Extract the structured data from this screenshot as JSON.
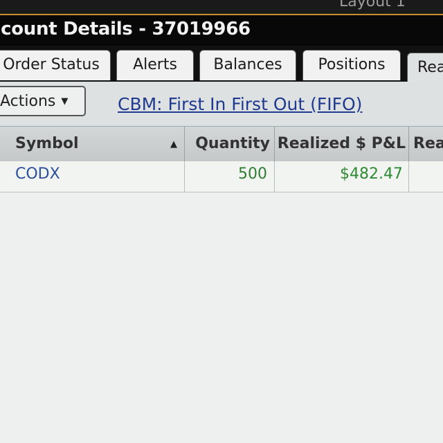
{
  "header": {
    "top_partial_right": "Layout 1",
    "account_title": "ccount Details -  37019966"
  },
  "tabs": [
    {
      "label": "Order Status"
    },
    {
      "label": "Alerts"
    },
    {
      "label": "Balances"
    },
    {
      "label": "Positions"
    },
    {
      "label": "Rea"
    }
  ],
  "toolbar": {
    "actions_label": "Actions",
    "cost_basis_method": "CBM: First In First Out (FIFO)"
  },
  "table": {
    "columns": [
      "Symbol",
      "Quantity",
      "Realized $ P&L",
      "Rea"
    ],
    "rows": [
      {
        "symbol": "CODX",
        "quantity": "500",
        "realized_pl": "$482.47",
        "extra": ""
      }
    ]
  },
  "colors": {
    "symbol_text": "#2c4f9a",
    "quantity_text": "#2f7d32",
    "pl_text": "#2f8a35",
    "link": "#1f3a8e"
  }
}
